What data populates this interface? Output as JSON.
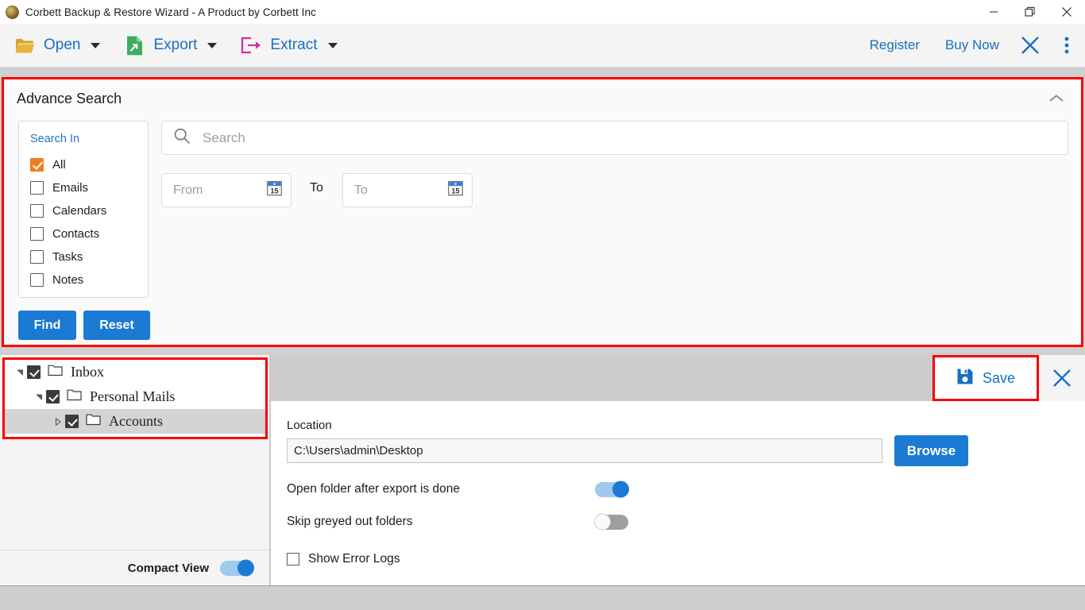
{
  "window": {
    "title": "Corbett Backup & Restore Wizard - A Product by Corbett Inc",
    "app_icon": "app-globe-icon",
    "minimize_icon": "minimize-icon",
    "maximize_icon": "restore-icon",
    "close_icon": "close-icon"
  },
  "toolbar": {
    "items": [
      {
        "label": "Open",
        "icon": "folder-open-icon",
        "caret": true
      },
      {
        "label": "Export",
        "icon": "export-file-icon",
        "caret": true
      },
      {
        "label": "Extract",
        "icon": "extract-arrow-icon",
        "caret": true
      }
    ],
    "register_label": "Register",
    "buy_now_label": "Buy Now",
    "close_icon": "close-x-icon",
    "more_icon": "more-vertical-icon"
  },
  "advance_search": {
    "title": "Advance Search",
    "collapse_icon": "chevron-up-icon",
    "search_in": {
      "title": "Search In",
      "options": [
        {
          "label": "All",
          "checked": true
        },
        {
          "label": "Emails",
          "checked": false
        },
        {
          "label": "Calendars",
          "checked": false
        },
        {
          "label": "Contacts",
          "checked": false
        },
        {
          "label": "Tasks",
          "checked": false
        },
        {
          "label": "Notes",
          "checked": false
        }
      ]
    },
    "find_label": "Find",
    "reset_label": "Reset",
    "search_placeholder": "Search",
    "search_value": "",
    "search_icon": "search-icon",
    "from_placeholder": "From",
    "from_value": "",
    "to_separator": "To",
    "to_placeholder": "To",
    "to_value": "",
    "calendar_icon": "calendar-15-icon"
  },
  "tree": {
    "nodes": [
      {
        "label": "Inbox",
        "checked": true,
        "expanded": true,
        "selected": false,
        "depth": 0
      },
      {
        "label": "Personal Mails",
        "checked": true,
        "expanded": true,
        "selected": false,
        "depth": 1
      },
      {
        "label": "Accounts",
        "checked": true,
        "expanded": false,
        "selected": true,
        "depth": 2
      }
    ],
    "folder_icon": "folder-icon",
    "compact_view_label": "Compact View",
    "compact_view_on": true
  },
  "right_panel": {
    "save_label": "Save",
    "save_icon": "save-floppy-icon",
    "close_icon": "close-x-icon",
    "location_label": "Location",
    "location_value": "C:\\Users\\admin\\Desktop",
    "browse_label": "Browse",
    "options": [
      {
        "label": "Open folder after export is done",
        "on": true
      },
      {
        "label": "Skip greyed out folders",
        "on": false
      }
    ],
    "show_error_logs_label": "Show Error Logs",
    "show_error_logs_checked": false
  },
  "colors": {
    "accent_blue": "#1570c4",
    "button_blue": "#1a7ad4",
    "highlight_red": "#f60000",
    "checkbox_orange": "#f07d1c",
    "folder_yellow": "#d9a22b",
    "export_green": "#3ead62",
    "extract_magenta": "#d72ba0"
  }
}
